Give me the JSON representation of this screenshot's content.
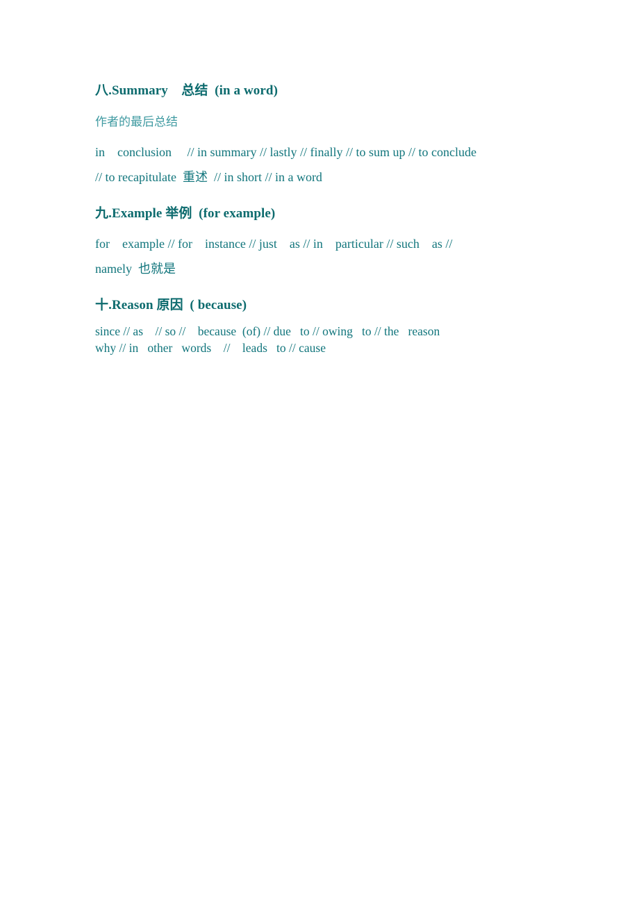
{
  "document": {
    "page_background": "#ffffff",
    "heading_color": "#0d6b6e",
    "body_color": "#11757c",
    "gloss_color": "#3f9aa1"
  },
  "sections": [
    {
      "id": "summary",
      "heading": "八.Summary    总结  (in a word)",
      "gloss": "作者的最后总结",
      "lines": [
        "in    conclusion     // in summary // lastly // finally // to sum up // to conclude",
        "// to recapitulate  重述  // in short // in a word"
      ]
    },
    {
      "id": "example",
      "heading": "九.Example 举例  (for example)",
      "lines": [
        "for    example // for    instance // just    as // in    particular // such    as //",
        "namely  也就是"
      ]
    },
    {
      "id": "reason",
      "heading": "十.Reason 原因  ( because)",
      "lines": [
        "since // as    // so //    because  (of) // due   to // owing   to // the   reason",
        "why // in   other   words    //    leads   to // cause"
      ]
    }
  ]
}
